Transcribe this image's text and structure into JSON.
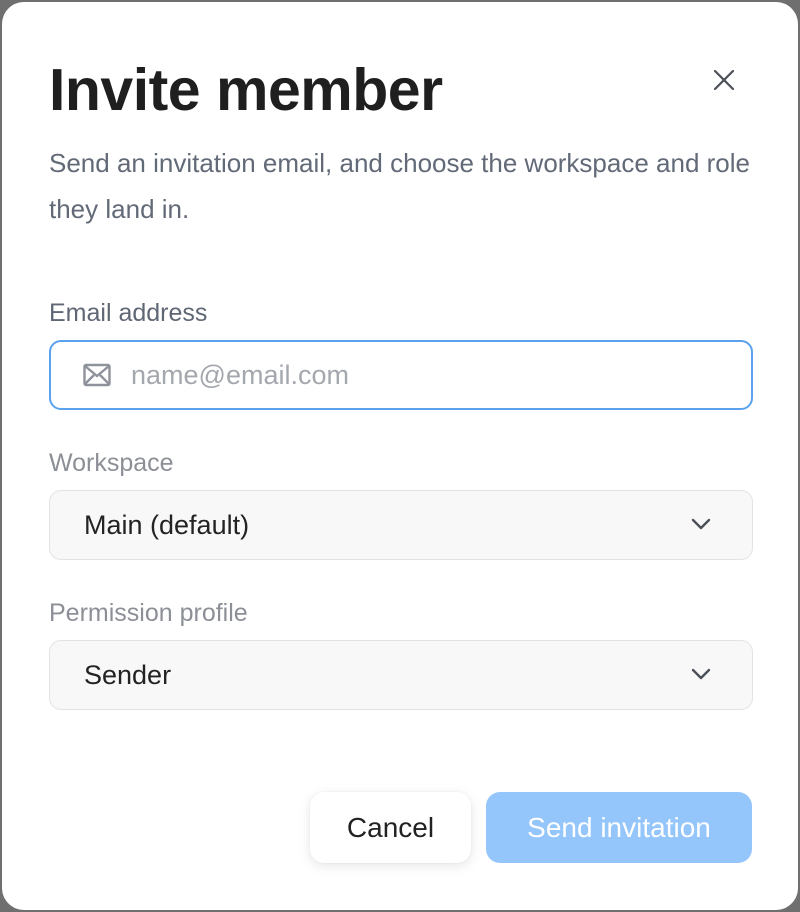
{
  "dialog": {
    "title": "Invite member",
    "subtitle": "Send an invitation email, and choose the workspace and role they land in.",
    "close_icon": "close-icon"
  },
  "email": {
    "label": "Email address",
    "placeholder": "name@email.com",
    "value": "",
    "icon": "mail-icon"
  },
  "workspace": {
    "label": "Workspace",
    "selected": "Main (default)",
    "icon": "chevron-down-icon"
  },
  "permission": {
    "label": "Permission profile",
    "selected": "Sender",
    "icon": "chevron-down-icon"
  },
  "actions": {
    "cancel_label": "Cancel",
    "send_label": "Send invitation"
  },
  "colors": {
    "accent": "#5aa2ee",
    "send_disabled": "#94c5fb",
    "title": "#1f1f1f",
    "subtitle": "#626a78"
  }
}
